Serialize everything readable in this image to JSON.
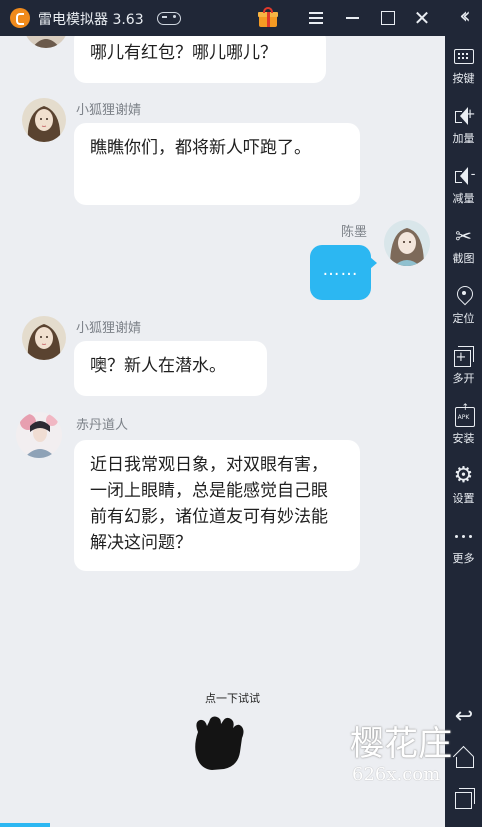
{
  "titlebar": {
    "app_title": "雷电模拟器 3.63"
  },
  "sidebar": {
    "tools": [
      {
        "label": "按键",
        "icon": "keyboard-icon"
      },
      {
        "label": "加量",
        "icon": "volume-up-icon"
      },
      {
        "label": "减量",
        "icon": "volume-down-icon"
      },
      {
        "label": "截图",
        "icon": "scissors-icon"
      },
      {
        "label": "定位",
        "icon": "location-pin-icon"
      },
      {
        "label": "多开",
        "icon": "multi-window-icon"
      },
      {
        "label": "安装",
        "icon": "apk-install-icon"
      },
      {
        "label": "设置",
        "icon": "gear-icon"
      },
      {
        "label": "更多",
        "icon": "more-icon"
      }
    ],
    "volume_up_sign": "+",
    "volume_down_sign": "-",
    "apk_text": "APK"
  },
  "chat": {
    "messages": [
      {
        "sender": "",
        "text": "哪儿有红包？哪儿哪儿？",
        "direction": "in"
      },
      {
        "sender": "小狐狸谢婧",
        "text": "瞧瞧你们，都将新人吓跑了。",
        "direction": "in"
      },
      {
        "sender": "陈墨",
        "text": "……",
        "direction": "out"
      },
      {
        "sender": "小狐狸谢婧",
        "text": "噢？新人在潜水。",
        "direction": "in"
      },
      {
        "sender": "赤丹道人",
        "text": "近日我常观日象，对双眼有害，一闭上眼睛，总是能感觉自己眼前有幻影，诸位道友可有妙法能解决这问题？",
        "direction": "in"
      }
    ]
  },
  "hint": {
    "label": "点一下试试"
  },
  "watermark": {
    "main": "樱花庄",
    "sub": "626x.com"
  },
  "colors": {
    "titlebar_bg": "#202737",
    "chat_bg": "#eceef2",
    "outgoing_bubble": "#2cb7f2",
    "logo": "#f08a1c"
  }
}
